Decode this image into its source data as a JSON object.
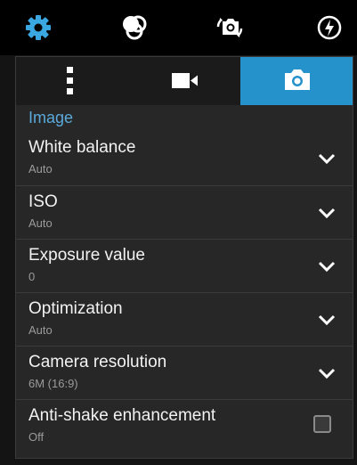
{
  "topbar": {
    "icons": [
      "gear-icon",
      "filter-effects-icon",
      "switch-camera-icon",
      "flash-auto-icon"
    ]
  },
  "tabs": [
    {
      "icon": "more-settings-icon",
      "active": false
    },
    {
      "icon": "video-camera-icon",
      "active": false
    },
    {
      "icon": "camera-icon",
      "active": true
    }
  ],
  "section_title": "Image",
  "settings": [
    {
      "label": "White balance",
      "value": "Auto"
    },
    {
      "label": "ISO",
      "value": "Auto"
    },
    {
      "label": "Exposure value",
      "value": "0"
    },
    {
      "label": "Optimization",
      "value": "Auto"
    },
    {
      "label": "Camera resolution",
      "value": "6M (16:9)"
    },
    {
      "label": "Anti-shake enhancement",
      "value": "Off"
    }
  ],
  "colors": {
    "accent": "#2592cc",
    "section_text": "#5aa9db",
    "icon_blue": "#3aa7e0"
  }
}
